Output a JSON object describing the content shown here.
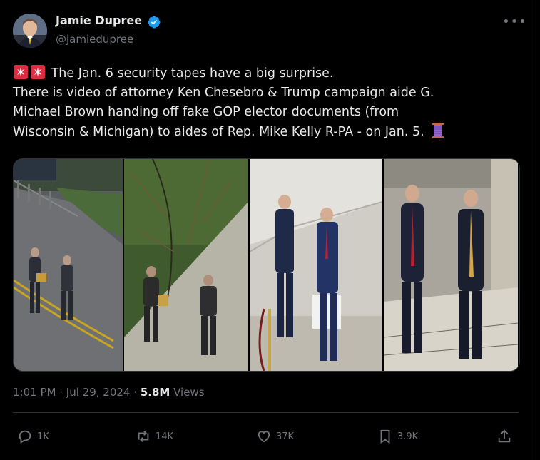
{
  "author": {
    "name": "Jamie Dupree",
    "handle": "@jamiedupree",
    "verified": true
  },
  "tweet": {
    "line1": "The Jan. 6 security tapes have a big surprise.",
    "line2": "There is video of attorney Ken Chesebro & Trump campaign aide G.",
    "line3": "Michael Brown handing off fake GOP elector documents (from",
    "line4": "Wisconsin & Michigan) to aides of Rep. Mike Kelly R-PA - on Jan. 5."
  },
  "meta": {
    "time": "1:01 PM",
    "date": "Jul 29, 2024",
    "views_count": "5.8M",
    "views_label": "Views",
    "sep": "·"
  },
  "actions": {
    "replies": "1K",
    "reposts": "14K",
    "likes": "37K",
    "bookmarks": "3.9K"
  },
  "icons": [
    "siren-emoji",
    "thread-emoji",
    "verified-badge-icon",
    "more-icon",
    "reply-icon",
    "repost-icon",
    "like-icon",
    "bookmark-icon",
    "share-icon"
  ],
  "colors": {
    "accent": "#1d9bf0",
    "muted": "#71767b",
    "text": "#e7e9ea",
    "bg": "#000000"
  }
}
